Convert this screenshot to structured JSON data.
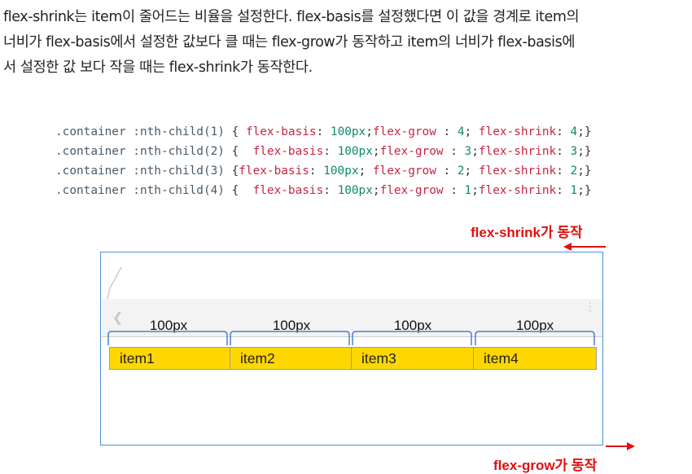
{
  "paragraph": {
    "lines": [
      "flex-shrink는 item이 줄어드는 비율을 설정한다. flex-basis를 설정했다면 이 값을 경계로 item의",
      "너비가 flex-basis에서 설정한 값보다 클 때는 flex-grow가 동작하고 item의 너비가 flex-basis에",
      "서 설정한 값 보다 작을 때는 flex-shrink가 동작한다."
    ]
  },
  "code": {
    "rules": [
      {
        "sel": ".container :nth-child(1)",
        "open": " { ",
        "d1": "flex-basis",
        "v1": "100px",
        "d2": "flex-grow",
        "v2": "4",
        "d3": "flex-shrink",
        "v3": "4"
      },
      {
        "sel": ".container :nth-child(2)",
        "open": " {  ",
        "d1": "flex-basis",
        "v1": "100px",
        "d2": "flex-grow",
        "v2": "3",
        "d3": "flex-shrink",
        "v3": "3"
      },
      {
        "sel": ".container :nth-child(3)",
        "open": " {",
        "d1": "flex-basis",
        "v1": "100px",
        "d2": "flex-grow",
        "v2": "2",
        "d3": "flex-shrink",
        "v3": "2"
      },
      {
        "sel": ".container :nth-child(4)",
        "open": " {  ",
        "d1": "flex-basis",
        "v1": "100px",
        "d2": "flex-grow",
        "v2": "1",
        "d3": "flex-shrink",
        "v3": "1"
      }
    ]
  },
  "diagram": {
    "shrink_label": "flex-shrink가 동작",
    "grow_label": "flex-grow가 동작",
    "basis_labels": [
      "100px",
      "100px",
      "100px",
      "100px"
    ],
    "items": [
      "item1",
      "item2",
      "item3",
      "item4"
    ],
    "colors": {
      "item_fill": "#ffd700",
      "frame": "#4a90d9",
      "brace": "#4a7fd0",
      "arrow": "#e01010"
    }
  }
}
